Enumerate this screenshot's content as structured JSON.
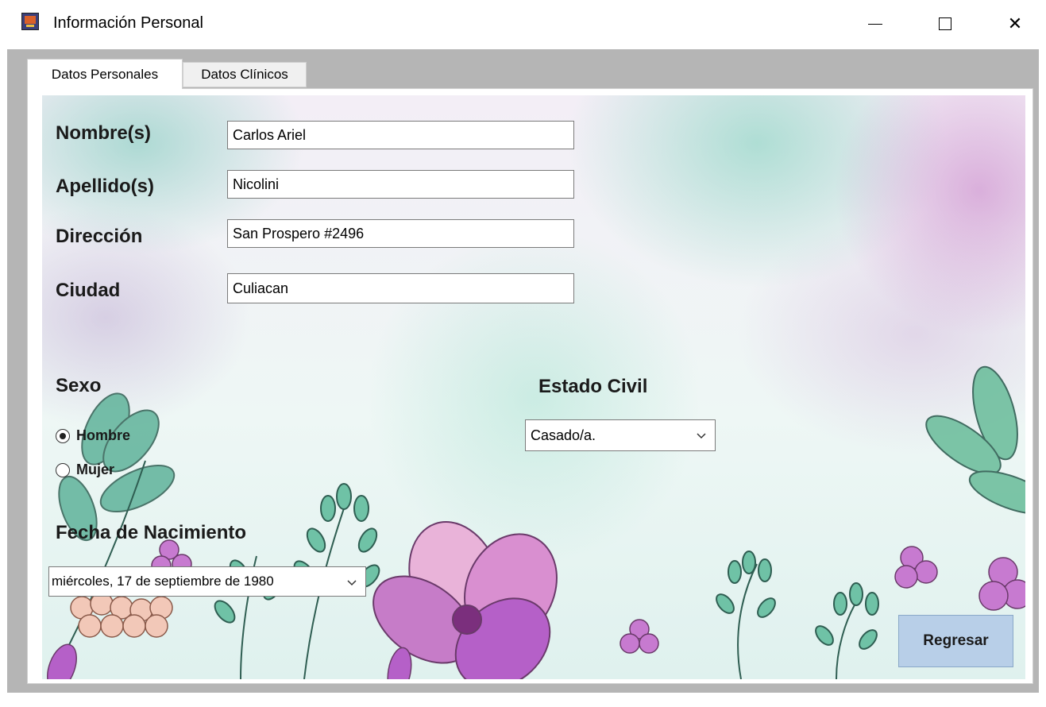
{
  "window": {
    "title": "Información Personal",
    "icon": "app-icon",
    "controls": [
      "minimize-icon",
      "maximize-icon",
      "close-icon"
    ],
    "close_glyph": "✕"
  },
  "tabs": [
    {
      "label": "Datos Personales",
      "selected": true
    },
    {
      "label": "Datos Clínicos",
      "selected": false
    }
  ],
  "form": {
    "nombre": {
      "label": "Nombre(s)",
      "value": "Carlos Ariel"
    },
    "apellido": {
      "label": "Apellido(s)",
      "value": "Nicolini"
    },
    "direccion": {
      "label": "Dirección",
      "value": "San Prospero #2496"
    },
    "ciudad": {
      "label": "Ciudad",
      "value": "Culiacan"
    },
    "sexo": {
      "label": "Sexo",
      "options": [
        {
          "label": "Hombre",
          "checked": true
        },
        {
          "label": "Mujer",
          "checked": false
        }
      ]
    },
    "estado_civil": {
      "label": "Estado Civil",
      "selected": "Casado/a."
    },
    "fecha_nacimiento": {
      "label": "Fecha de Nacimiento",
      "value": "miércoles, 17 de septiembre de 1980"
    },
    "regresar_label": "Regresar"
  },
  "colors": {
    "client_bg": "#b5b5b5",
    "button_bg": "#b8cfe8",
    "flower_purple": "#b560c8",
    "leaf_green": "#5fb39a"
  }
}
